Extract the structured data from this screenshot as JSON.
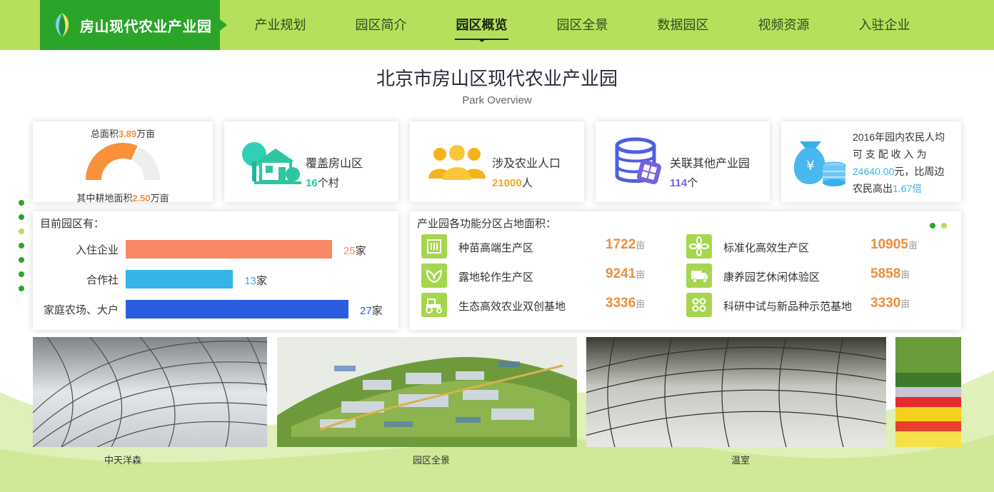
{
  "nav": {
    "brand": "房山现代农业产业园",
    "items": [
      "产业规划",
      "园区简介",
      "园区概览",
      "园区全景",
      "数据园区",
      "视频资源",
      "入驻企业"
    ],
    "active": "园区概览"
  },
  "title": "北京市房山区现代农业产业园",
  "subtitle": "Park Overview",
  "area": {
    "total_prefix": "总面积",
    "total_value": "3.89",
    "total_unit": "万亩",
    "farm_prefix": "其中耕地面积",
    "farm_value": "2.50",
    "farm_unit": "万亩",
    "gauge_fraction": 0.64
  },
  "stats": [
    {
      "icon": "house-tree-icon",
      "label": "覆盖房山区",
      "value": "16",
      "unit": "个村"
    },
    {
      "icon": "people-icon",
      "label": "涉及农业人口",
      "value": "21000",
      "unit": "人"
    },
    {
      "icon": "database-icon",
      "label": "关联其他产业园",
      "value": "114",
      "unit": "个"
    }
  ],
  "income": {
    "line1": "2016年园内农民人均",
    "line2": "可 支 配 收 入 为",
    "value": "24640.00",
    "line3_suffix": "元，比周边",
    "line4_prefix": "农民高出",
    "ratio": "1.67倍"
  },
  "park_count": {
    "title": "目前园区有：",
    "rows": [
      {
        "label": "入住企业",
        "value": 25,
        "unit": "家",
        "color": "#f98866"
      },
      {
        "label": "合作社",
        "value": 13,
        "unit": "家",
        "color": "#33b5e8"
      },
      {
        "label": "家庭农场、大户",
        "value": 27,
        "unit": "家",
        "color": "#2b5de0"
      }
    ]
  },
  "zones": {
    "title": "产业园各功能分区占地面积：",
    "unit": "亩",
    "items": [
      {
        "icon": "building-icon",
        "name": "种苗高端生产区",
        "value": "1722"
      },
      {
        "icon": "flower-icon",
        "name": "标准化高效生产区",
        "value": "10905"
      },
      {
        "icon": "leaf-icon",
        "name": "露地轮作生产区",
        "value": "9241"
      },
      {
        "icon": "truck-icon",
        "name": "康养园艺休闲体验区",
        "value": "5858"
      },
      {
        "icon": "tractor-icon",
        "name": "生态高效农业双创基地",
        "value": "3336"
      },
      {
        "icon": "grid-icon",
        "name": "科研中试与新品种示范基地",
        "value": "3330"
      }
    ]
  },
  "photos": [
    {
      "caption": "中天洋森",
      "kind": "greenhouse"
    },
    {
      "caption": "园区全景",
      "kind": "aerial"
    },
    {
      "caption": "温室",
      "kind": "greenhouse"
    },
    {
      "caption": "",
      "kind": "flowers"
    }
  ],
  "colors": {
    "nav_bg": "#b5e05c",
    "brand_bg": "#2aa52a",
    "accent_orange": "#f08c3a"
  }
}
